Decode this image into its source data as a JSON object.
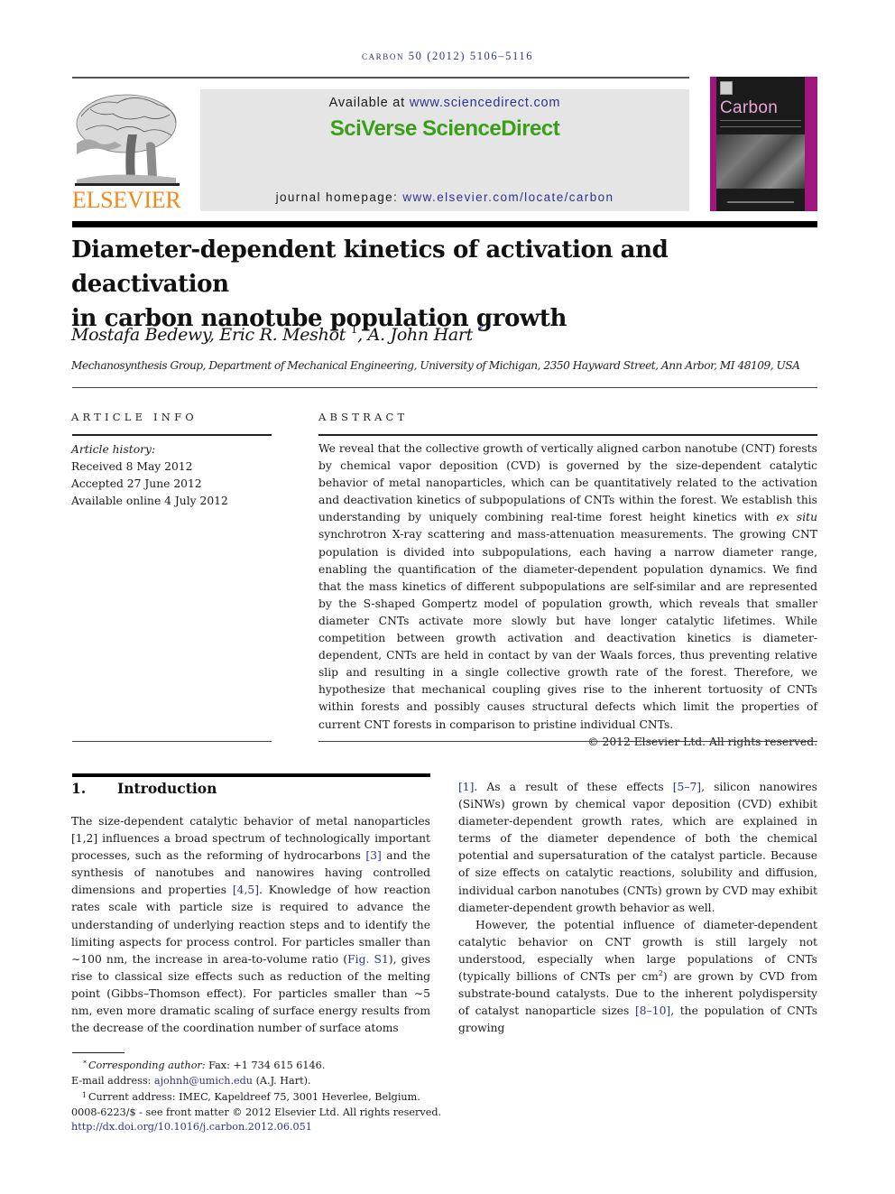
{
  "running_head": "carbon 50 (2012) 5106–5116",
  "masthead": {
    "publisher_logo_text": "ELSEVIER",
    "available_prefix": "Available at ",
    "available_url": "www.sciencedirect.com",
    "brand": "SciVerse ScienceDirect",
    "homepage_prefix": "journal homepage: ",
    "homepage_url": "www.elsevier.com/locate/carbon",
    "journal_cover_title": "Carbon",
    "colors": {
      "brand_green": "#3a9e1a",
      "elsevier_orange": "#f08a1c",
      "cover_magenta": "#a0157e",
      "link_blue": "#2b3590"
    }
  },
  "article": {
    "title_line1": "Diameter-dependent kinetics of activation and deactivation",
    "title_line2": "in carbon nanotube population growth",
    "authors": [
      {
        "name": "Mostafa Bedewy",
        "mark": ""
      },
      {
        "name": "Eric R. Meshot",
        "mark": "1"
      },
      {
        "name": "A. John Hart",
        "mark": "*"
      }
    ],
    "affiliation": "Mechanosynthesis Group, Department of Mechanical Engineering, University of Michigan, 2350 Hayward Street, Ann Arbor, MI 48109, USA"
  },
  "article_info": {
    "heading": "ARTICLE INFO",
    "history_label": "Article history:",
    "received": "Received 8 May 2012",
    "accepted": "Accepted 27 June 2012",
    "online": "Available online 4 July 2012"
  },
  "abstract": {
    "heading": "ABSTRACT",
    "text_part1": "We reveal that the collective growth of vertically aligned carbon nanotube (CNT) forests by chemical vapor deposition (CVD) is governed by the size-dependent catalytic behavior of metal nanoparticles, which can be quantitatively related to the activation and deactivation kinetics of subpopulations of CNTs within the forest. We establish this understanding by uniquely combining real-time forest height kinetics with ",
    "text_italic": "ex situ",
    "text_part2": " synchrotron X-ray scattering and mass-attenuation measurements. The growing CNT population is divided into subpopulations, each having a narrow diameter range, enabling the quantification of the diameter-dependent population dynamics. We find that the mass kinetics of different subpopulations are self-similar and are represented by the S-shaped Gompertz model of population growth, which reveals that smaller diameter CNTs activate more slowly but have longer catalytic lifetimes. While competition between growth activation and deactivation kinetics is diameter-dependent, CNTs are held in contact by van der Waals forces, thus preventing relative slip and resulting in a single collective growth rate of the forest. Therefore, we hypothesize that mechanical coupling gives rise to the inherent tortuosity of CNTs within forests and possibly causes structural defects which limit the properties of current CNT forests in comparison to pristine individual CNTs.",
    "copyright": "© 2012 Elsevier Ltd. All rights reserved."
  },
  "section1": {
    "number": "1.",
    "title": "Introduction",
    "p1_a": "The size-dependent catalytic behavior of metal nanoparticles [1,2] influences a broad spectrum of technologically important processes, such as the reforming of hydrocarbons ",
    "ref3": "[3]",
    "p1_b": " and the synthesis of nanotubes and nanowires having controlled dimensions and properties ",
    "ref45": "[4,5]",
    "p1_c": ". Knowledge of how reaction rates scale with particle size is required to advance the understanding of underlying reaction steps and to identify the limiting aspects for process control. For particles smaller than ∼100 nm, the increase in area-to-volume ratio (",
    "figS1": "Fig. S1",
    "p1_d": "), gives rise to classical size effects such as reduction of the melting point (Gibbs–Thomson effect). For particles smaller than ∼5 nm, even more dramatic scaling of surface energy results from the decrease of the coordination number of surface atoms ",
    "ref1": "[1]",
    "p1_e": ". As a result of these effects ",
    "ref57": "[5–7]",
    "p1_f": ", silicon nanowires (SiNWs) grown by chemical vapor deposition (CVD) exhibit diameter-dependent growth rates, which are explained in terms of the diameter dependence of both the chemical potential and supersaturation of the catalyst particle. Because of size effects on catalytic reactions, solubility and diffusion, individual carbon nanotubes (CNTs) grown by CVD may exhibit diameter-dependent growth behavior as well.",
    "p2_a": "However, the potential influence of diameter-dependent catalytic behavior on CNT growth is still largely not understood, especially when large populations of CNTs (typically billions of CNTs per cm",
    "p2_sup": "2",
    "p2_b": ") are grown by CVD from substrate-bound catalysts. Due to the inherent polydispersity of catalyst nanoparticle sizes ",
    "ref810": "[8–10]",
    "p2_c": ", the population of CNTs growing"
  },
  "footnotes": {
    "corr_mark": "*",
    "corr_label": "Corresponding author:",
    "corr_text": " Fax: +1 734 615 6146.",
    "email_label": "E-mail address: ",
    "email": "ajohnh@umich.edu",
    "email_suffix": " (A.J. Hart).",
    "addr_mark": "1",
    "addr_text": "Current address: IMEC, Kapeldreef 75, 3001 Heverlee, Belgium.",
    "front_matter": "0008-6223/$ - see front matter © 2012 Elsevier Ltd. All rights reserved.",
    "doi": "http://dx.doi.org/10.1016/j.carbon.2012.06.051"
  }
}
